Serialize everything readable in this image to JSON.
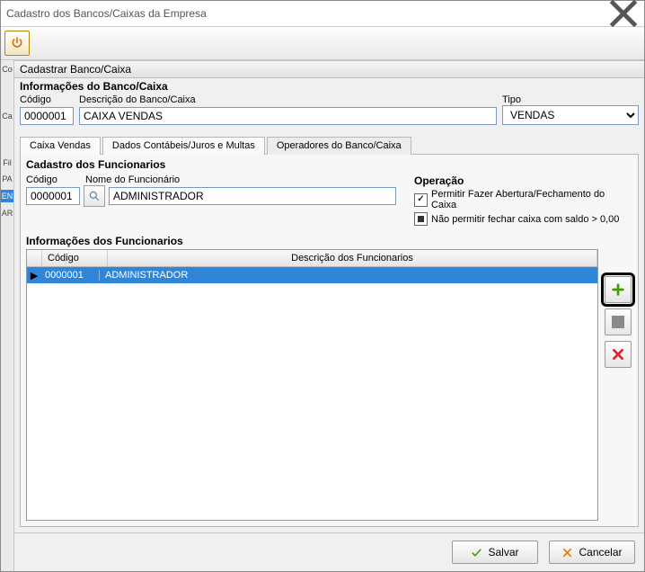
{
  "window": {
    "title": "Cadastro dos Bancos/Caixas da Empresa"
  },
  "section": {
    "register": "Cadastrar Banco/Caixa"
  },
  "info": {
    "group_title": "Informações do Banco/Caixa",
    "codigo_label": "Código",
    "descricao_label": "Descrição do Banco/Caixa",
    "tipo_label": "Tipo",
    "codigo_value": "0000001",
    "descricao_value": "CAIXA VENDAS",
    "tipo_value": "VENDAS"
  },
  "tabs": {
    "t1": "Caixa Vendas",
    "t2": "Dados Contábeis/Juros e Multas",
    "t3": "Operadores do Banco/Caixa"
  },
  "cadastro": {
    "title": "Cadastro dos Funcionarios",
    "codigo_label": "Código",
    "nome_label": "Nome do Funcionário",
    "codigo_value": "0000001",
    "nome_value": "ADMINISTRADOR"
  },
  "operacao": {
    "title": "Operação",
    "permitir": "Permitir Fazer Abertura/Fechamento do Caixa",
    "nao_permitir": "Não permitir fechar caixa com saldo > 0,00"
  },
  "grid": {
    "title": "Informações dos Funcionarios",
    "col_codigo": "Código",
    "col_desc": "Descrição dos Funcionarios",
    "rows": [
      {
        "codigo": "0000001",
        "descricao": "ADMINISTRADOR"
      }
    ]
  },
  "buttons": {
    "save": "Salvar",
    "cancel": "Cancelar"
  },
  "leftstrip": {
    "a": "Co",
    "b": "Ca",
    "c": "Fil",
    "d": "PA",
    "e": "EN",
    "f": "AR"
  }
}
